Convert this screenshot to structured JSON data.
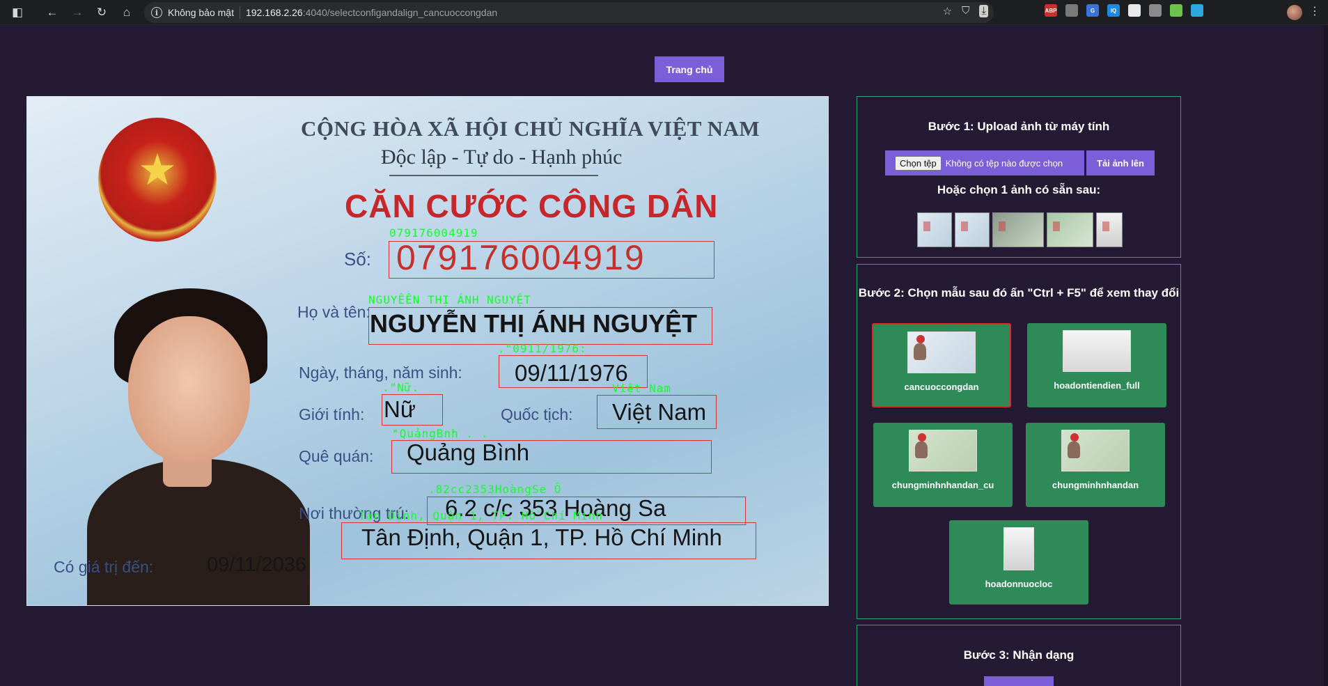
{
  "browser": {
    "security_label": "Không bảo mật",
    "url_host": "192.168.2.26",
    "url_path": ":4040/selectconfigandalign_cancuoccongdan",
    "extensions": [
      {
        "name": "adblock-icon",
        "text": "ABP",
        "color": "#c9302c"
      },
      {
        "name": "download-helper-icon",
        "text": "",
        "color": "#7a7a7a"
      },
      {
        "name": "translate-icon",
        "text": "G",
        "color": "#3b73d9"
      },
      {
        "name": "iq-icon",
        "text": "IQ",
        "color": "#1e88e5"
      },
      {
        "name": "color-picker-icon",
        "text": "",
        "color": "#e8e8e8"
      },
      {
        "name": "record-icon",
        "text": "",
        "color": "#8a8a8a"
      },
      {
        "name": "green-arrow-icon",
        "text": "",
        "color": "#6cc24a"
      },
      {
        "name": "bug-icon",
        "text": "",
        "color": "#29a9e0"
      }
    ]
  },
  "page": {
    "home_button": "Trang chủ"
  },
  "id_card": {
    "republic": "CỘNG HÒA XÃ HỘI CHỦ NGHĨA VIỆT NAM",
    "motto": "Độc lập - Tự do - Hạnh phúc",
    "title": "CĂN CƯỚC CÔNG DÂN",
    "labels": {
      "number": "Số:",
      "name": "Họ và tên:",
      "dob": "Ngày, tháng, năm sinh:",
      "sex": "Giới tính:",
      "nationality": "Quốc tịch:",
      "hometown": "Quê quán:",
      "residence": "Nơi thường trú:",
      "expiry": "Có giá trị đến:"
    },
    "values": {
      "number": "079176004919",
      "name": "NGUYỄN THỊ ÁNH NGUYỆT",
      "dob": "09/11/1976",
      "sex": "Nữ",
      "nationality": "Việt Nam",
      "hometown": "Quảng Bình",
      "residence_1": "6.2 c/c 353 Hoàng Sa",
      "residence_2": "Tân Định, Quận 1, TP. Hồ Chí Minh",
      "expiry": "09/11/2036"
    },
    "ocr": {
      "number": "079176004919",
      "name": "NGUYÊÊN THỊ ÁNH NGUYỆT",
      "dob": ".\"0911/1976:",
      "sex": ".\"Nữ.",
      "nationality": "Việt Nam",
      "hometown": "\"QuảngBnh . .",
      "residence_1": ".82cc2353HoàngSe Ô",
      "residence_2": "Tân Định, Quận 1, TP. Hồ Chí Minh"
    }
  },
  "step1": {
    "title": "Bước 1: Upload ảnh từ máy tính",
    "choose_file": "Chọn tệp",
    "no_file": "Không có tệp nào được chọn",
    "upload": "Tải ảnh lên",
    "or_choose": "Hoặc chọn 1 ảnh có sẵn sau:"
  },
  "step2": {
    "title": "Bước 2: Chọn mẫu sau đó ấn \"Ctrl + F5\" để xem thay đổi",
    "templates": [
      {
        "label": "cancuoccongdan",
        "selected": true
      },
      {
        "label": "hoadontiendien_full",
        "selected": false
      },
      {
        "label": "chungminhnhandan_cu",
        "selected": false
      },
      {
        "label": "chungminhnhandan",
        "selected": false
      },
      {
        "label": "hoadonnuocloc",
        "selected": false
      }
    ]
  },
  "step3": {
    "title": "Bước 3: Nhận dạng"
  }
}
